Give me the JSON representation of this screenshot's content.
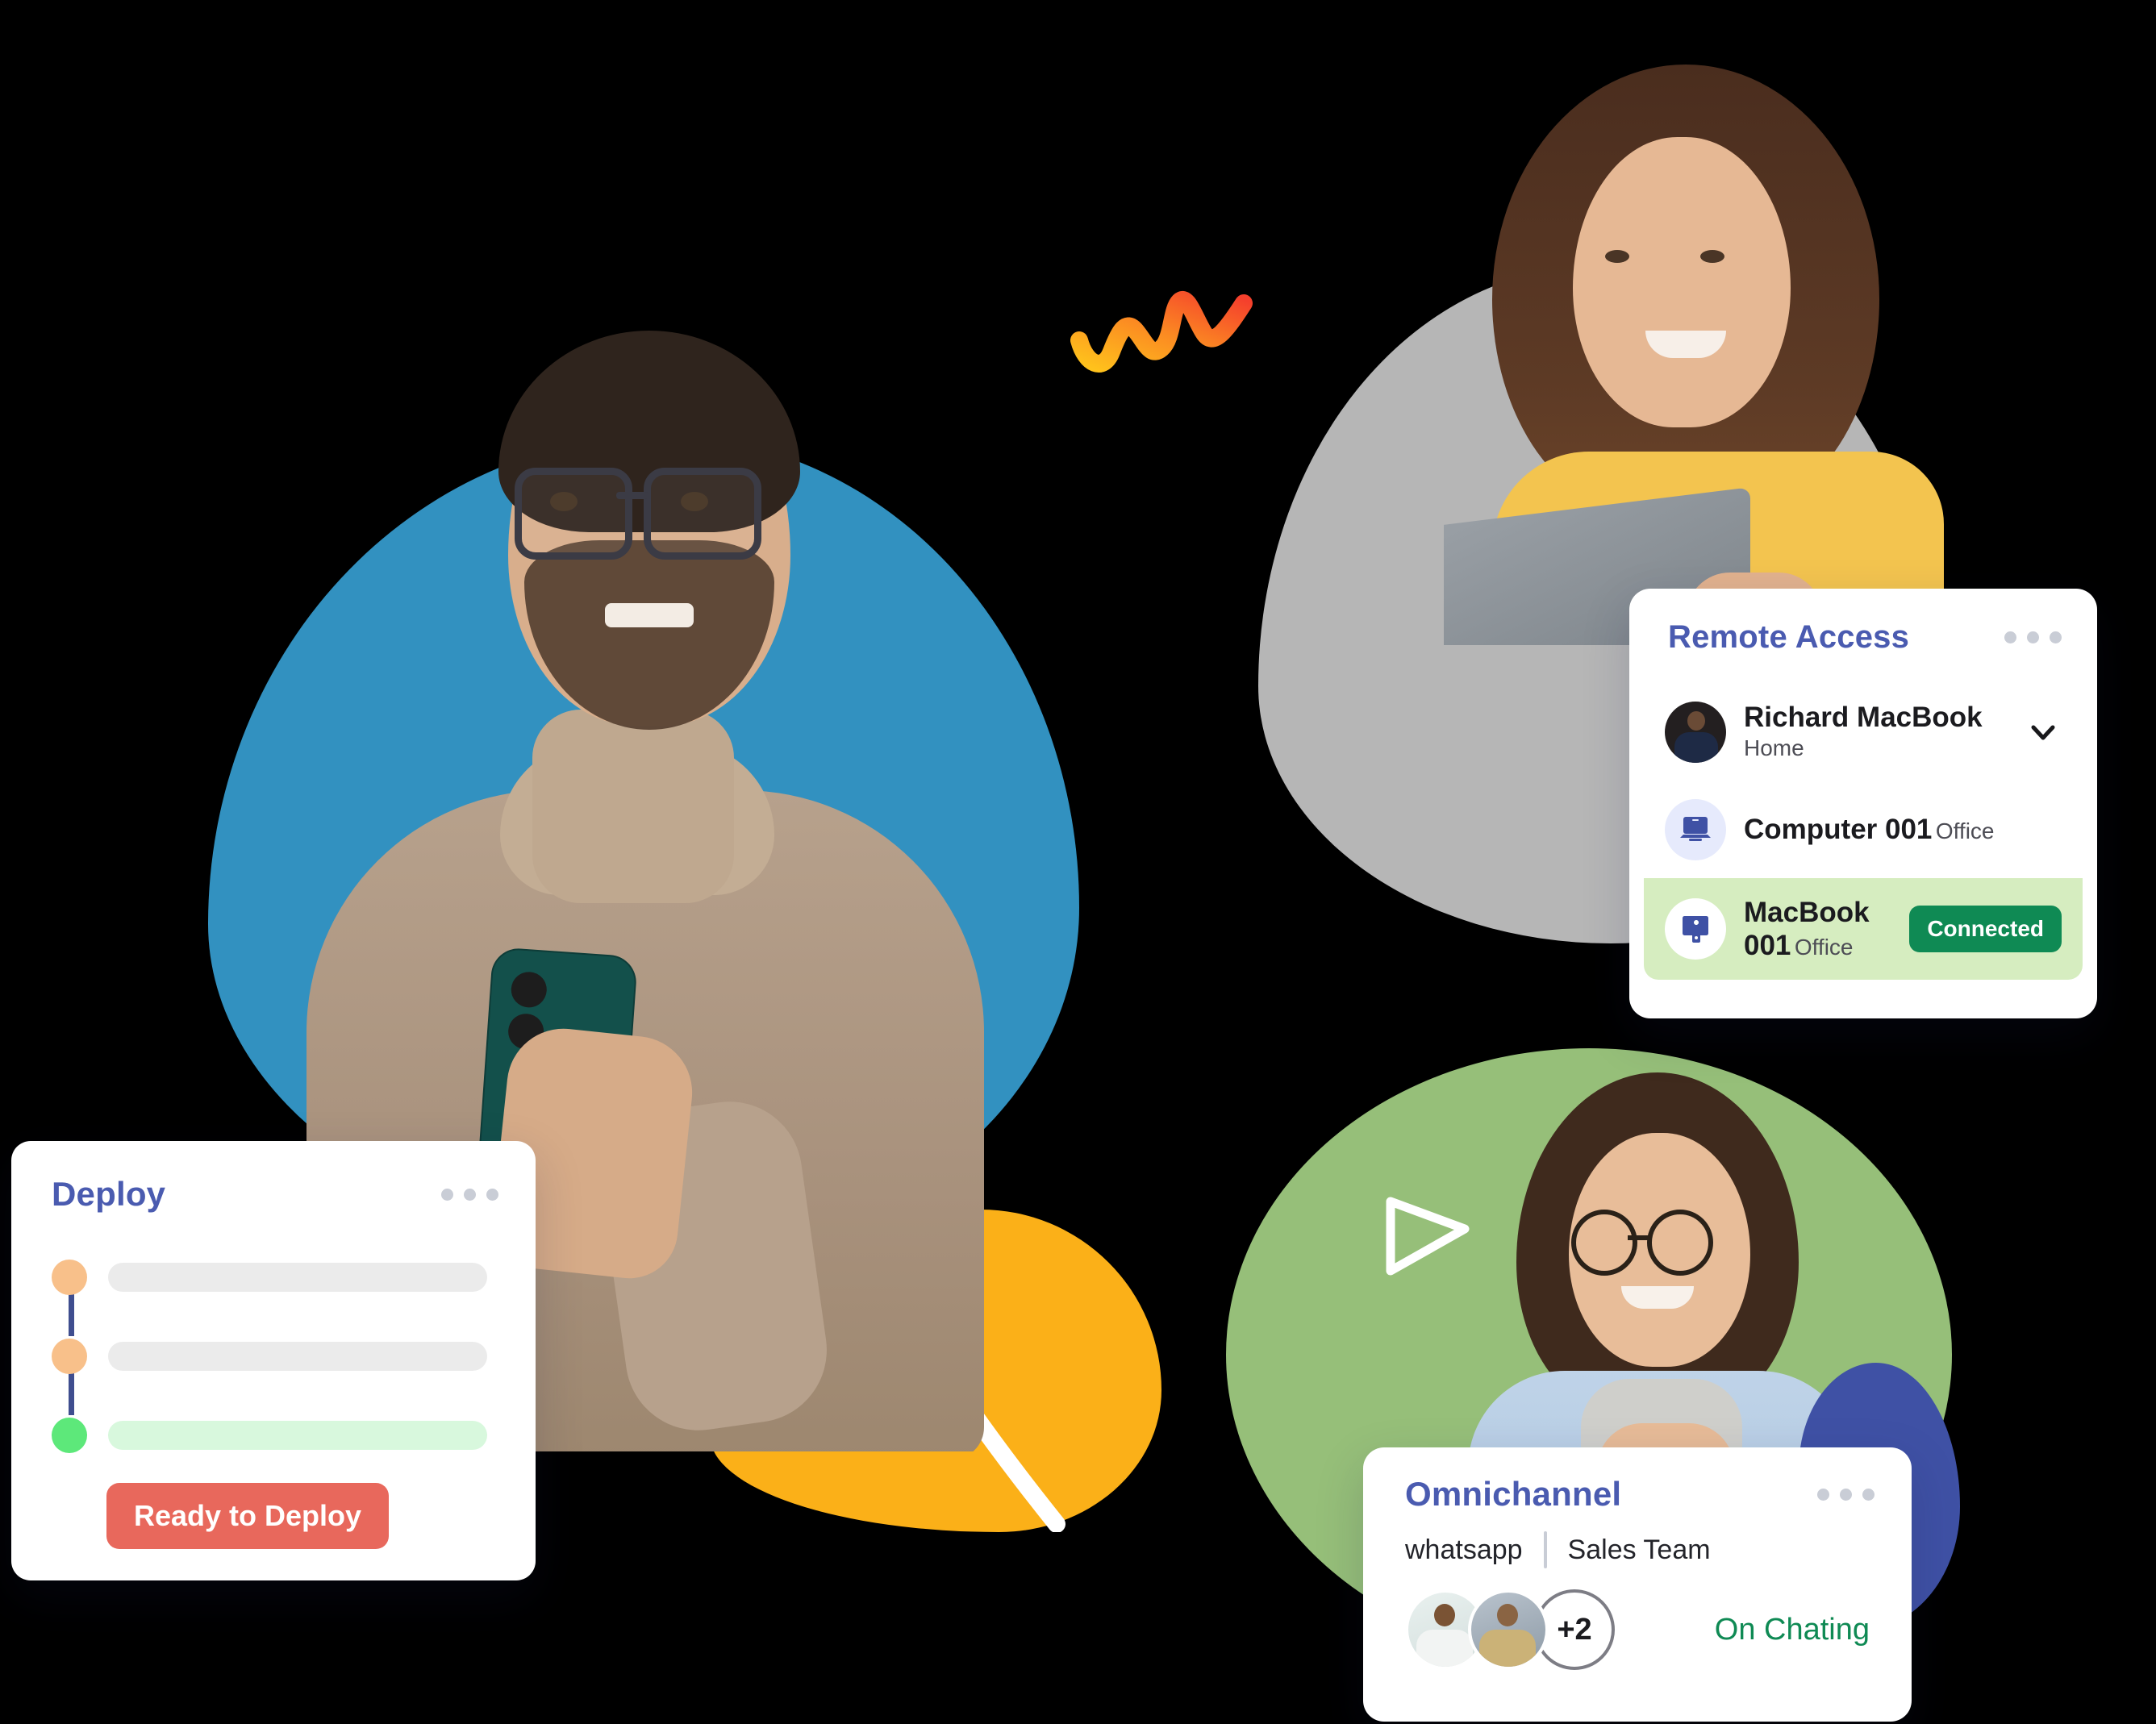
{
  "decorations": {
    "blob_blue": "#3291c0",
    "blob_yellow": "#fbb018",
    "blob_gray": "#b6b6b6",
    "blob_green": "#96bf79",
    "blob_dark_blue": "#3f51a5",
    "squiggle_start": "#ffc21c",
    "squiggle_end": "#f5402c",
    "arrow_icon": "send-arrow-outline"
  },
  "deploy_card": {
    "title": "Deploy",
    "menu_icon": "more-options-dots",
    "steps": [
      {
        "dot_color": "#f8c08a",
        "bar_color": "#ebebeb",
        "state": "pending"
      },
      {
        "dot_color": "#f8c08a",
        "bar_color": "#ebebeb",
        "state": "pending"
      },
      {
        "dot_color": "#5de87a",
        "bar_color": "#d8f8dd",
        "state": "done"
      }
    ],
    "connector_color": "#3f4e8f",
    "button_label": "Ready to Deploy",
    "button_color": "#e8685c"
  },
  "remote_access_card": {
    "title": "Remote Access",
    "menu_icon": "more-options-dots",
    "chevron_icon": "chevron-down-icon",
    "devices": [
      {
        "name": "Richard MacBook",
        "location": "Home",
        "icon": "user-avatar",
        "state": "collapsed",
        "badge": null
      },
      {
        "name": "Computer 001",
        "location": "Office",
        "icon": "laptop-icon",
        "state": "idle",
        "badge": null
      },
      {
        "name": "MacBook 001",
        "location": "Office",
        "icon": "imac-apple-icon",
        "state": "connected",
        "badge": "Connected"
      }
    ],
    "badge_color": "#0f8a54",
    "active_row_color": "#d6edc0"
  },
  "omnichannel_card": {
    "title": "Omnichannel",
    "menu_icon": "more-options-dots",
    "channel": "whatsapp",
    "team": "Sales Team",
    "extra_members": "+2",
    "status": "On Chating",
    "status_color": "#0f8a54",
    "avatars": [
      {
        "icon": "member-avatar-1"
      },
      {
        "icon": "member-avatar-2"
      }
    ]
  }
}
